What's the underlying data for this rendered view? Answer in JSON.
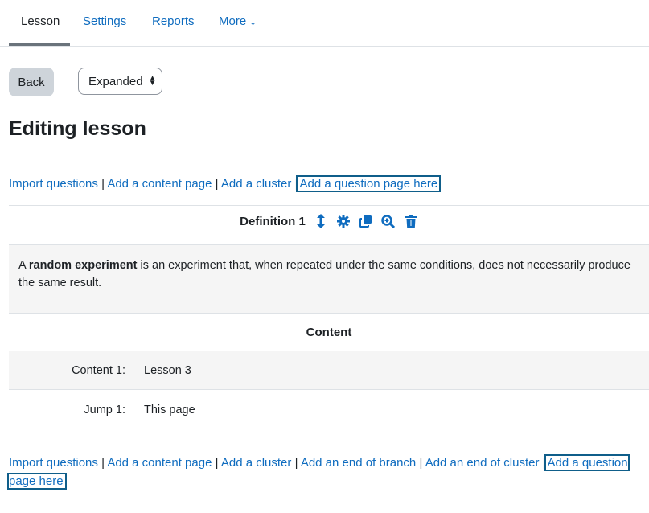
{
  "tabs": [
    {
      "label": "Lesson",
      "active": true
    },
    {
      "label": "Settings"
    },
    {
      "label": "Reports"
    },
    {
      "label": "More"
    }
  ],
  "toolbar": {
    "back_label": "Back",
    "view_select": "Expanded"
  },
  "page_heading": "Editing lesson",
  "top_links": [
    "Import questions",
    "Add a content page",
    "Add a cluster",
    "Add a question page here"
  ],
  "lesson_page": {
    "title": "Definition 1",
    "icons": [
      "move-icon",
      "settings-icon",
      "duplicate-icon",
      "preview-icon",
      "delete-icon"
    ],
    "description_prefix": "A ",
    "description_bold": "random experiment",
    "description_rest": " is an experiment that, when repeated under the same conditions, does not necessarily produce the same result.",
    "content_header": "Content",
    "rows": [
      {
        "label": "Content 1:",
        "value": "Lesson 3"
      },
      {
        "label": "Jump 1:",
        "value": "This page"
      }
    ]
  },
  "bottom_links": [
    "Import questions",
    "Add a content page",
    "Add a cluster",
    "Add an end of branch",
    "Add an end of cluster",
    "Add a question page here"
  ],
  "separator": "|"
}
